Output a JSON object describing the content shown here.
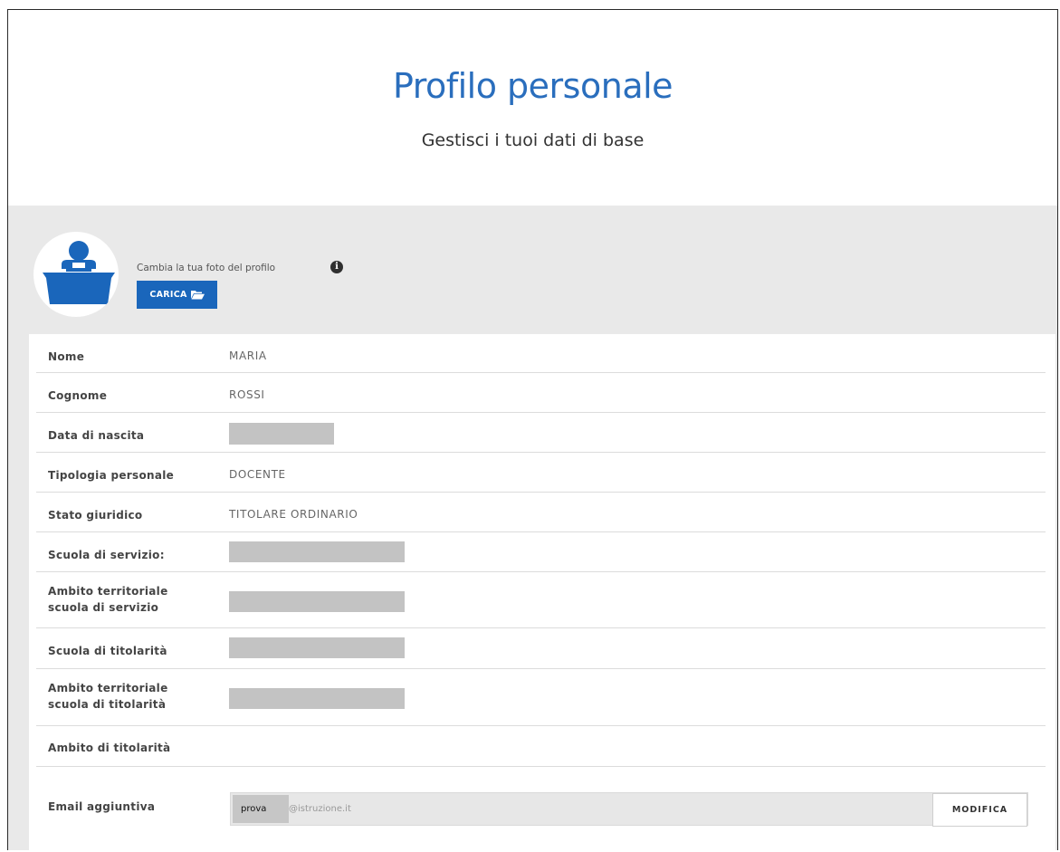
{
  "header": {
    "title": "Profilo personale",
    "subtitle": "Gestisci i tuoi dati di base"
  },
  "profile": {
    "change_photo_label": "Cambia la tua foto del profilo",
    "upload_button": "CARICA"
  },
  "fields": [
    {
      "label": "Nome",
      "value": "MARIA"
    },
    {
      "label": "Cognome",
      "value": "ROSSI"
    },
    {
      "label": "Data di nascita",
      "value": ""
    },
    {
      "label": "Tipologia personale",
      "value": "DOCENTE"
    },
    {
      "label": "Stato giuridico",
      "value": "TITOLARE ORDINARIO"
    },
    {
      "label": "Scuola di servizio:",
      "value": ""
    },
    {
      "label": "Ambito territoriale scuola di servizio",
      "value": ""
    },
    {
      "label": "Scuola di titolarità",
      "value": ""
    },
    {
      "label": "Ambito territoriale scuola di titolarità",
      "value": ""
    },
    {
      "label": "Ambito di titolarità",
      "value": ""
    }
  ],
  "email": {
    "label": "Email aggiuntiva",
    "prefix": "prova",
    "domain": "@istruzione.it",
    "modify_button": "MODIFICA"
  },
  "colors": {
    "title": "#2a6ebd",
    "button": "#1a66bb",
    "band": "#e9e9e9"
  }
}
